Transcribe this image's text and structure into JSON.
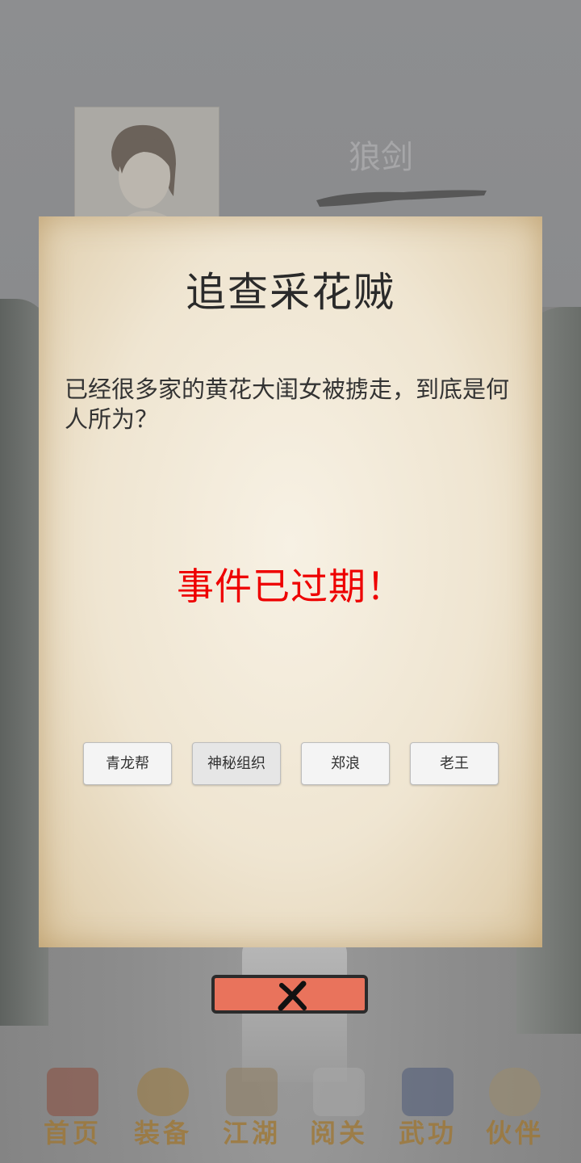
{
  "hero": {
    "name": "狼剑"
  },
  "dialog": {
    "title": "追查采花贼",
    "description": "已经很多家的黄花大闺女被掳走，到底是何人所为？",
    "status": "事件已过期！",
    "options": [
      "青龙帮",
      "神秘组织",
      "郑浪",
      "老王"
    ]
  },
  "nav": {
    "items": [
      {
        "label": "首页",
        "icon": "house-icon"
      },
      {
        "label": "装备",
        "icon": "jar-icon"
      },
      {
        "label": "江湖",
        "icon": "scroll-icon"
      },
      {
        "label": "阅关",
        "icon": "book-icon"
      },
      {
        "label": "武功",
        "icon": "manual-icon"
      },
      {
        "label": "伙伴",
        "icon": "companions-icon"
      }
    ]
  },
  "colors": {
    "accent": "#e9735c",
    "expired": "#ee0000",
    "nav_label": "#a0762f"
  }
}
